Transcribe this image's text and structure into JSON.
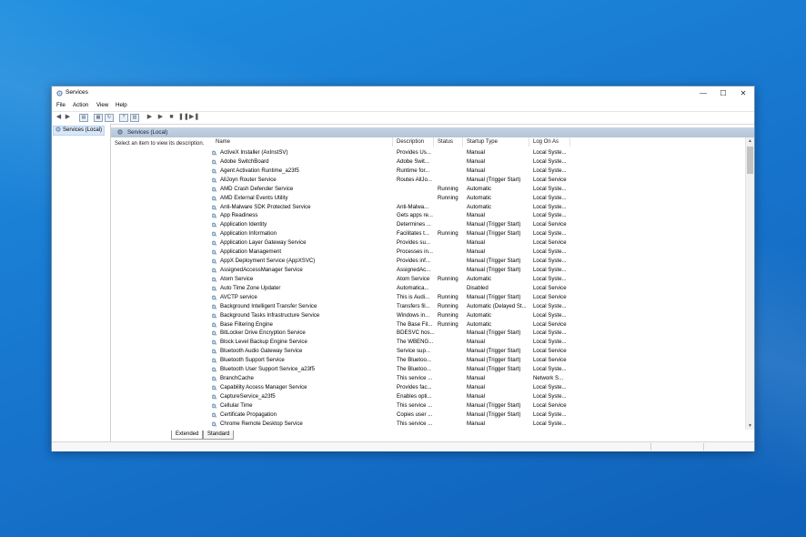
{
  "window": {
    "title": "Services"
  },
  "window_controls": {
    "minimize": "—",
    "maximize": "☐",
    "close": "✕"
  },
  "menu": [
    "File",
    "Action",
    "View",
    "Help"
  ],
  "tree": {
    "root_label": "Services (Local)"
  },
  "pane": {
    "header": "Services (Local)",
    "description": "Select an item to view its description."
  },
  "columns": [
    "Name",
    "Description",
    "Status",
    "Startup Type",
    "Log On As"
  ],
  "services": [
    [
      "ActiveX Installer (AxInstSV)",
      "Provides Us...",
      "",
      "Manual",
      "Local Syste..."
    ],
    [
      "Adobe SwitchBoard",
      "Adobe Swit...",
      "",
      "Manual",
      "Local Syste..."
    ],
    [
      "Agent Activation Runtime_a23f5",
      "Runtime for...",
      "",
      "Manual",
      "Local Syste..."
    ],
    [
      "AllJoyn Router Service",
      "Routes AllJo...",
      "",
      "Manual (Trigger Start)",
      "Local Service"
    ],
    [
      "AMD Crash Defender Service",
      "",
      "Running",
      "Automatic",
      "Local Syste..."
    ],
    [
      "AMD External Events Utility",
      "",
      "Running",
      "Automatic",
      "Local Syste..."
    ],
    [
      "Anti-Malware SDK Protected Service",
      "Anti-Malwa...",
      "",
      "Automatic",
      "Local Syste..."
    ],
    [
      "App Readiness",
      "Gets apps re...",
      "",
      "Manual",
      "Local Syste..."
    ],
    [
      "Application Identity",
      "Determines ...",
      "",
      "Manual (Trigger Start)",
      "Local Service"
    ],
    [
      "Application Information",
      "Facilitates t...",
      "Running",
      "Manual (Trigger Start)",
      "Local Syste..."
    ],
    [
      "Application Layer Gateway Service",
      "Provides su...",
      "",
      "Manual",
      "Local Service"
    ],
    [
      "Application Management",
      "Processes in...",
      "",
      "Manual",
      "Local Syste..."
    ],
    [
      "AppX Deployment Service (AppXSVC)",
      "Provides inf...",
      "",
      "Manual (Trigger Start)",
      "Local Syste..."
    ],
    [
      "AssignedAccessManager Service",
      "AssignedAc...",
      "",
      "Manual (Trigger Start)",
      "Local Syste..."
    ],
    [
      "Atom Service",
      "Atom Service",
      "Running",
      "Automatic",
      "Local Syste..."
    ],
    [
      "Auto Time Zone Updater",
      "Automatica...",
      "",
      "Disabled",
      "Local Service"
    ],
    [
      "AVCTP service",
      "This is Audi...",
      "Running",
      "Manual (Trigger Start)",
      "Local Service"
    ],
    [
      "Background Intelligent Transfer Service",
      "Transfers fil...",
      "Running",
      "Automatic (Delayed St...",
      "Local Syste..."
    ],
    [
      "Background Tasks Infrastructure Service",
      "Windows in...",
      "Running",
      "Automatic",
      "Local Syste..."
    ],
    [
      "Base Filtering Engine",
      "The Base Fil...",
      "Running",
      "Automatic",
      "Local Service"
    ],
    [
      "BitLocker Drive Encryption Service",
      "BDESVC hos...",
      "",
      "Manual (Trigger Start)",
      "Local Syste..."
    ],
    [
      "Block Level Backup Engine Service",
      "The WBENG...",
      "",
      "Manual",
      "Local Syste..."
    ],
    [
      "Bluetooth Audio Gateway Service",
      "Service sup...",
      "",
      "Manual (Trigger Start)",
      "Local Service"
    ],
    [
      "Bluetooth Support Service",
      "The Bluetoo...",
      "",
      "Manual (Trigger Start)",
      "Local Service"
    ],
    [
      "Bluetooth User Support Service_a23f5",
      "The Bluetoo...",
      "",
      "Manual (Trigger Start)",
      "Local Syste..."
    ],
    [
      "BranchCache",
      "This service ...",
      "",
      "Manual",
      "Network S..."
    ],
    [
      "Capability Access Manager Service",
      "Provides fac...",
      "",
      "Manual",
      "Local Syste..."
    ],
    [
      "CaptureService_a23f5",
      "Enables opti...",
      "",
      "Manual",
      "Local Syste..."
    ],
    [
      "Cellular Time",
      "This service ...",
      "",
      "Manual (Trigger Start)",
      "Local Service"
    ],
    [
      "Certificate Propagation",
      "Copies user ...",
      "",
      "Manual (Trigger Start)",
      "Local Syste..."
    ],
    [
      "Chrome Remote Desktop Service",
      "This service ...",
      "",
      "Manual",
      "Local Syste..."
    ]
  ],
  "tabs": [
    "Extended",
    "Standard"
  ],
  "scroll": {
    "up": "▲",
    "down": "▼"
  },
  "colors": {
    "desktop": "#1877cf",
    "pane_header": "#bccbdd",
    "gear": "#6f8fb3"
  }
}
